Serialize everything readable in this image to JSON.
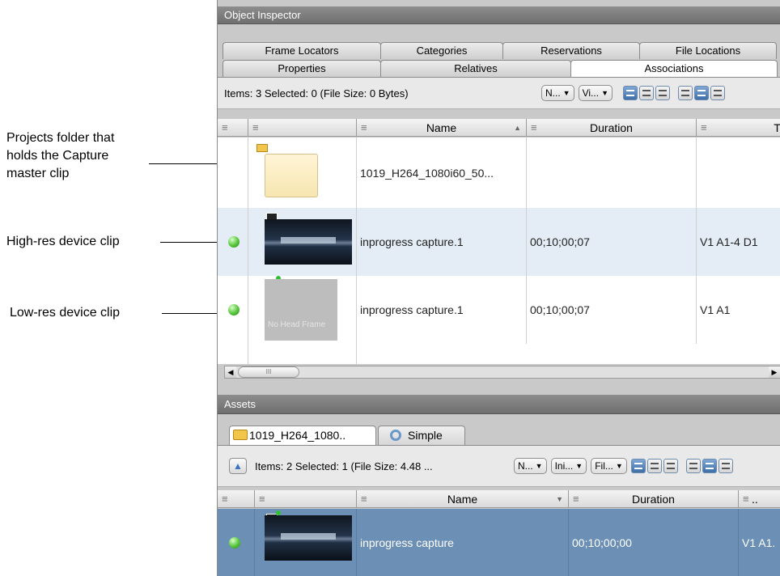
{
  "callouts": {
    "projects_folder": [
      "Projects folder that",
      "holds the Capture",
      "master clip"
    ],
    "high_res": "High-res device clip",
    "low_res": "Low-res device clip"
  },
  "inspector": {
    "title": "Object Inspector",
    "tabs_row1": [
      "Frame Locators",
      "Categories",
      "Reservations",
      "File Locations"
    ],
    "tabs_row2": [
      "Properties",
      "Relatives",
      "Associations"
    ],
    "active_tab": "Associations",
    "status": "Items: 3 Selected: 0 (File Size: 0 Bytes)",
    "combos": [
      "N...",
      "Vi..."
    ],
    "columns": [
      "",
      "",
      "Name",
      "Duration",
      "Tr"
    ],
    "sorted_column": "Name",
    "sort_direction": "ascending",
    "rows": [
      {
        "name": "1019_H264_1080i60_50...",
        "duration": "",
        "tracks": "",
        "type": "folder",
        "status": "none"
      },
      {
        "name": "inprogress capture.1",
        "duration": "00;10;00;07",
        "tracks": "V1 A1-4 D1",
        "type": "clip",
        "status": "online",
        "selected_bg": true
      },
      {
        "name": "inprogress capture.1",
        "duration": "00;10;00;07",
        "tracks": "V1 A1",
        "type": "clip",
        "status": "online",
        "thumb_text": "No Head Frame"
      }
    ],
    "scroll_thumb": "III"
  },
  "assets": {
    "title": "Assets",
    "tabs": [
      "1019_H264_1080..",
      "Simple"
    ],
    "status": "Items: 2 Selected: 1 (File Size: 4.48 ...",
    "combos": [
      "N...",
      "Ini...",
      "Fil..."
    ],
    "columns": [
      "",
      "",
      "Name",
      "Duration",
      ".."
    ],
    "sorted_column": "Name",
    "sort_direction": "descending",
    "rows": [
      {
        "name": "inprogress capture",
        "duration": "00;10;00;00",
        "tracks": "V1 A1.",
        "status": "online",
        "selected": true
      }
    ]
  },
  "colors": {
    "selection": "#6b8fb5",
    "row_highlight": "#e4edf5",
    "panel_title": "#7a7a7a"
  }
}
